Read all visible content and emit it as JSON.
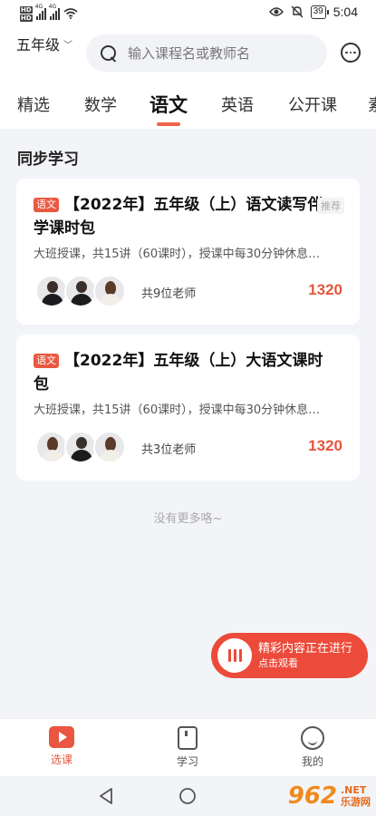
{
  "status_bar": {
    "network_type_1": "4G",
    "network_type_2": "4G",
    "battery": "39",
    "time": "5:04"
  },
  "header": {
    "grade": "五年级",
    "search_placeholder": "输入课程名或教师名"
  },
  "tabs": [
    {
      "label": "精选"
    },
    {
      "label": "数学"
    },
    {
      "label": "语文"
    },
    {
      "label": "英语"
    },
    {
      "label": "公开课"
    },
    {
      "label": "素"
    }
  ],
  "section": {
    "title": "同步学习"
  },
  "courses": [
    {
      "subject_tag": "语文",
      "title": "【2022年】五年级（上）语文读写伴学课时包",
      "badge": "推荐",
      "description": "大班授课，共15讲（60课时），授课中每30分钟休息…",
      "teacher_count": "共9位老师",
      "price": "1320"
    },
    {
      "subject_tag": "语文",
      "title": "【2022年】五年级（上）大语文课时包",
      "description": "大班授课，共15讲（60课时），授课中每30分钟休息…",
      "teacher_count": "共3位老师",
      "price": "1320"
    }
  ],
  "list_end": "没有更多咯~",
  "live_banner": {
    "title": "精彩内容正在进行",
    "subtitle": "点击观看"
  },
  "bottom_nav": [
    {
      "label": "选课",
      "icon": "play-icon"
    },
    {
      "label": "学习",
      "icon": "book-icon"
    },
    {
      "label": "我的",
      "icon": "profile-icon"
    }
  ],
  "watermark": {
    "number": "962",
    "suffix": ".NET",
    "text": "乐游网"
  },
  "colors": {
    "accent": "#e5573e",
    "background": "#f3f4f8"
  }
}
